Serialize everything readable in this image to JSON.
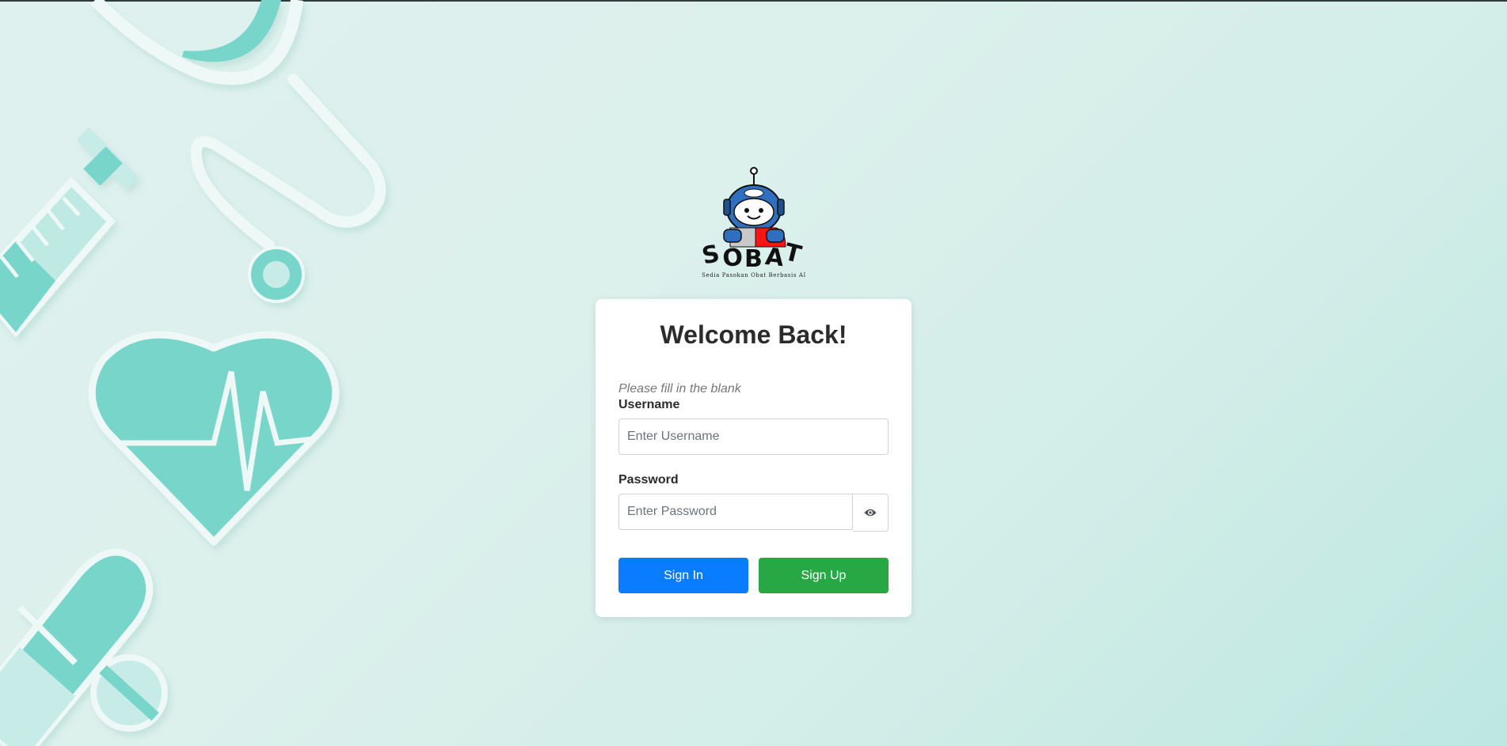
{
  "logo": {
    "brand": "SOBAT",
    "tagline": "Sedia Pasokan Obat Berbasis AI"
  },
  "login": {
    "title": "Welcome Back!",
    "hint": "Please fill in the blank",
    "username": {
      "label": "Username",
      "placeholder": "Enter Username",
      "value": ""
    },
    "password": {
      "label": "Password",
      "placeholder": "Enter Password",
      "value": ""
    },
    "toggle_visibility_icon": "eye-icon",
    "sign_in_label": "Sign In",
    "sign_up_label": "Sign Up"
  },
  "background_icons": [
    "stethoscope-icon",
    "syringe-icon",
    "heart-pulse-icon",
    "pill-capsule-icon",
    "pill-tablet-icon"
  ],
  "colors": {
    "background": "#dcf0ec",
    "illustration": "#78d5ca",
    "primary": "#0a7cff",
    "success": "#28a745",
    "card": "#ffffff"
  }
}
